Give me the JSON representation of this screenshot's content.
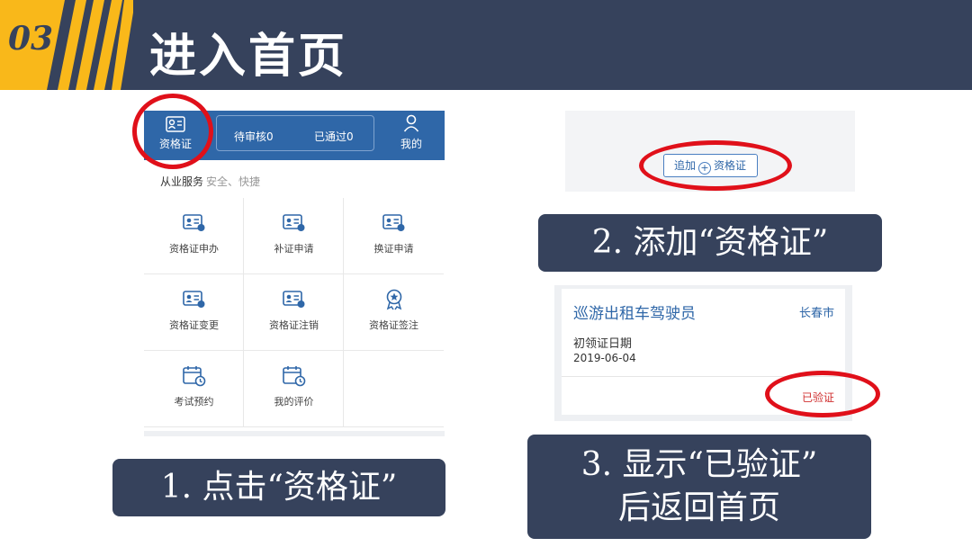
{
  "header": {
    "number": "03",
    "title": "进入首页",
    "colors": {
      "bar": "#36425c",
      "accent": "#f9b81a"
    }
  },
  "phone_left": {
    "tabs": {
      "cert": {
        "label": "资格证",
        "icon": "id-card-icon"
      },
      "pending": "待审核0",
      "passed": "已通过0",
      "mine": {
        "label": "我的",
        "icon": "user-icon"
      }
    },
    "section": {
      "title": "从业服务",
      "subtitle": "安全、快捷"
    },
    "services": [
      {
        "label": "资格证申办",
        "icon": "id-card-apply-icon"
      },
      {
        "label": "补证申请",
        "icon": "id-card-reissue-icon"
      },
      {
        "label": "换证申请",
        "icon": "id-card-renew-icon"
      },
      {
        "label": "资格证变更",
        "icon": "id-card-change-icon"
      },
      {
        "label": "资格证注销",
        "icon": "id-card-cancel-icon"
      },
      {
        "label": "资格证签注",
        "icon": "award-badge-icon"
      },
      {
        "label": "考试预约",
        "icon": "calendar-clock-icon"
      },
      {
        "label": "我的评价",
        "icon": "calendar-clock-icon"
      }
    ],
    "colors": {
      "topbar": "#2f67a8"
    }
  },
  "add_panel": {
    "button_label_before": "追加",
    "button_label_after": "资格证",
    "icon": "plus-circle-icon"
  },
  "cert_card": {
    "title": "巡游出租车驾驶员",
    "city": "长春市",
    "date_label": "初领证日期",
    "date": "2019-06-04",
    "status": "已验证",
    "colors": {
      "status": "#d03030"
    }
  },
  "captions": {
    "step1": "1. 点击“资格证”",
    "step2": "2. 添加“资格证”",
    "step3_line1": "3. 显示“已验证”",
    "step3_line2": "后返回首页"
  },
  "highlight_color": "#e0101a"
}
